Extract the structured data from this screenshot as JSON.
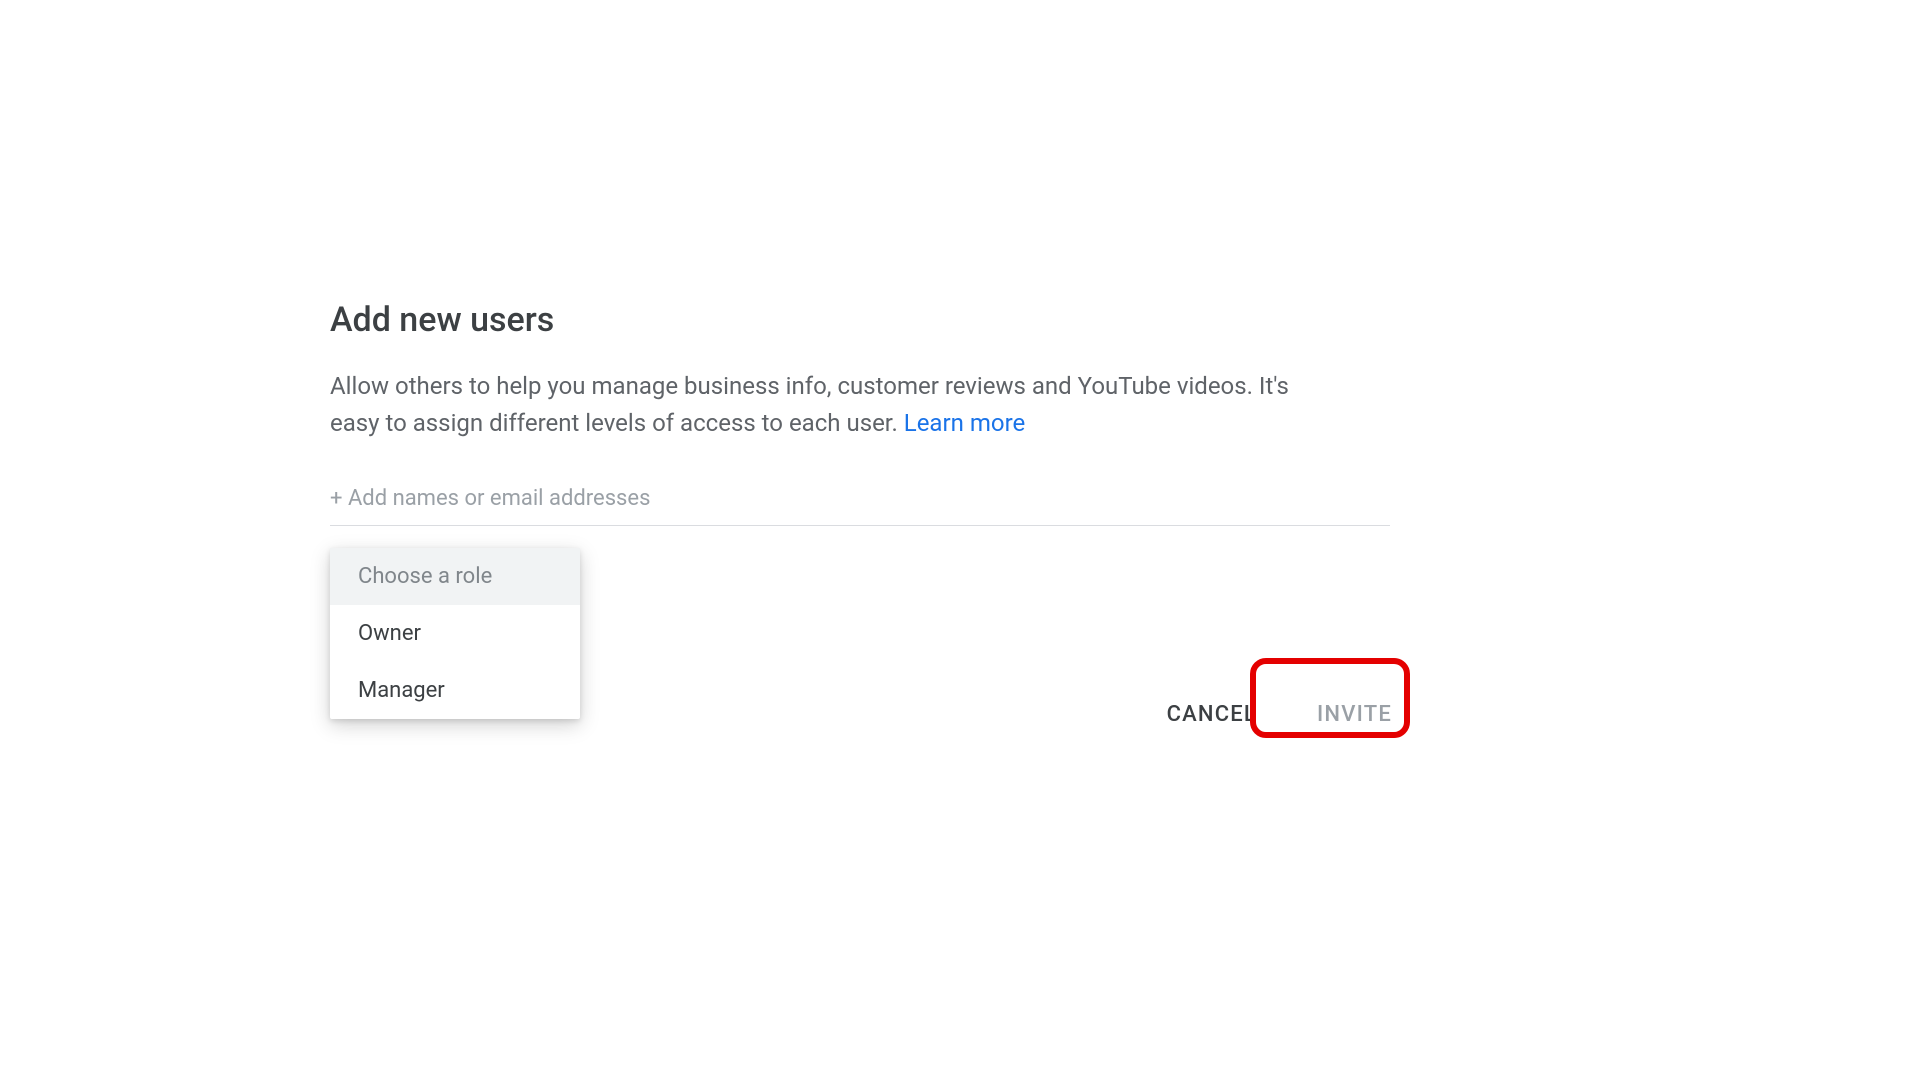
{
  "dialog": {
    "title": "Add new users",
    "description": "Allow others to help you manage business info, customer reviews and YouTube videos. It's easy to assign different levels of access to each user. ",
    "learn_more": "Learn more",
    "input_placeholder": "+ Add names or email addresses"
  },
  "role_dropdown": {
    "header": "Choose a role",
    "options": [
      "Owner",
      "Manager"
    ]
  },
  "buttons": {
    "cancel": "CANCEL",
    "invite": "INVITE"
  }
}
